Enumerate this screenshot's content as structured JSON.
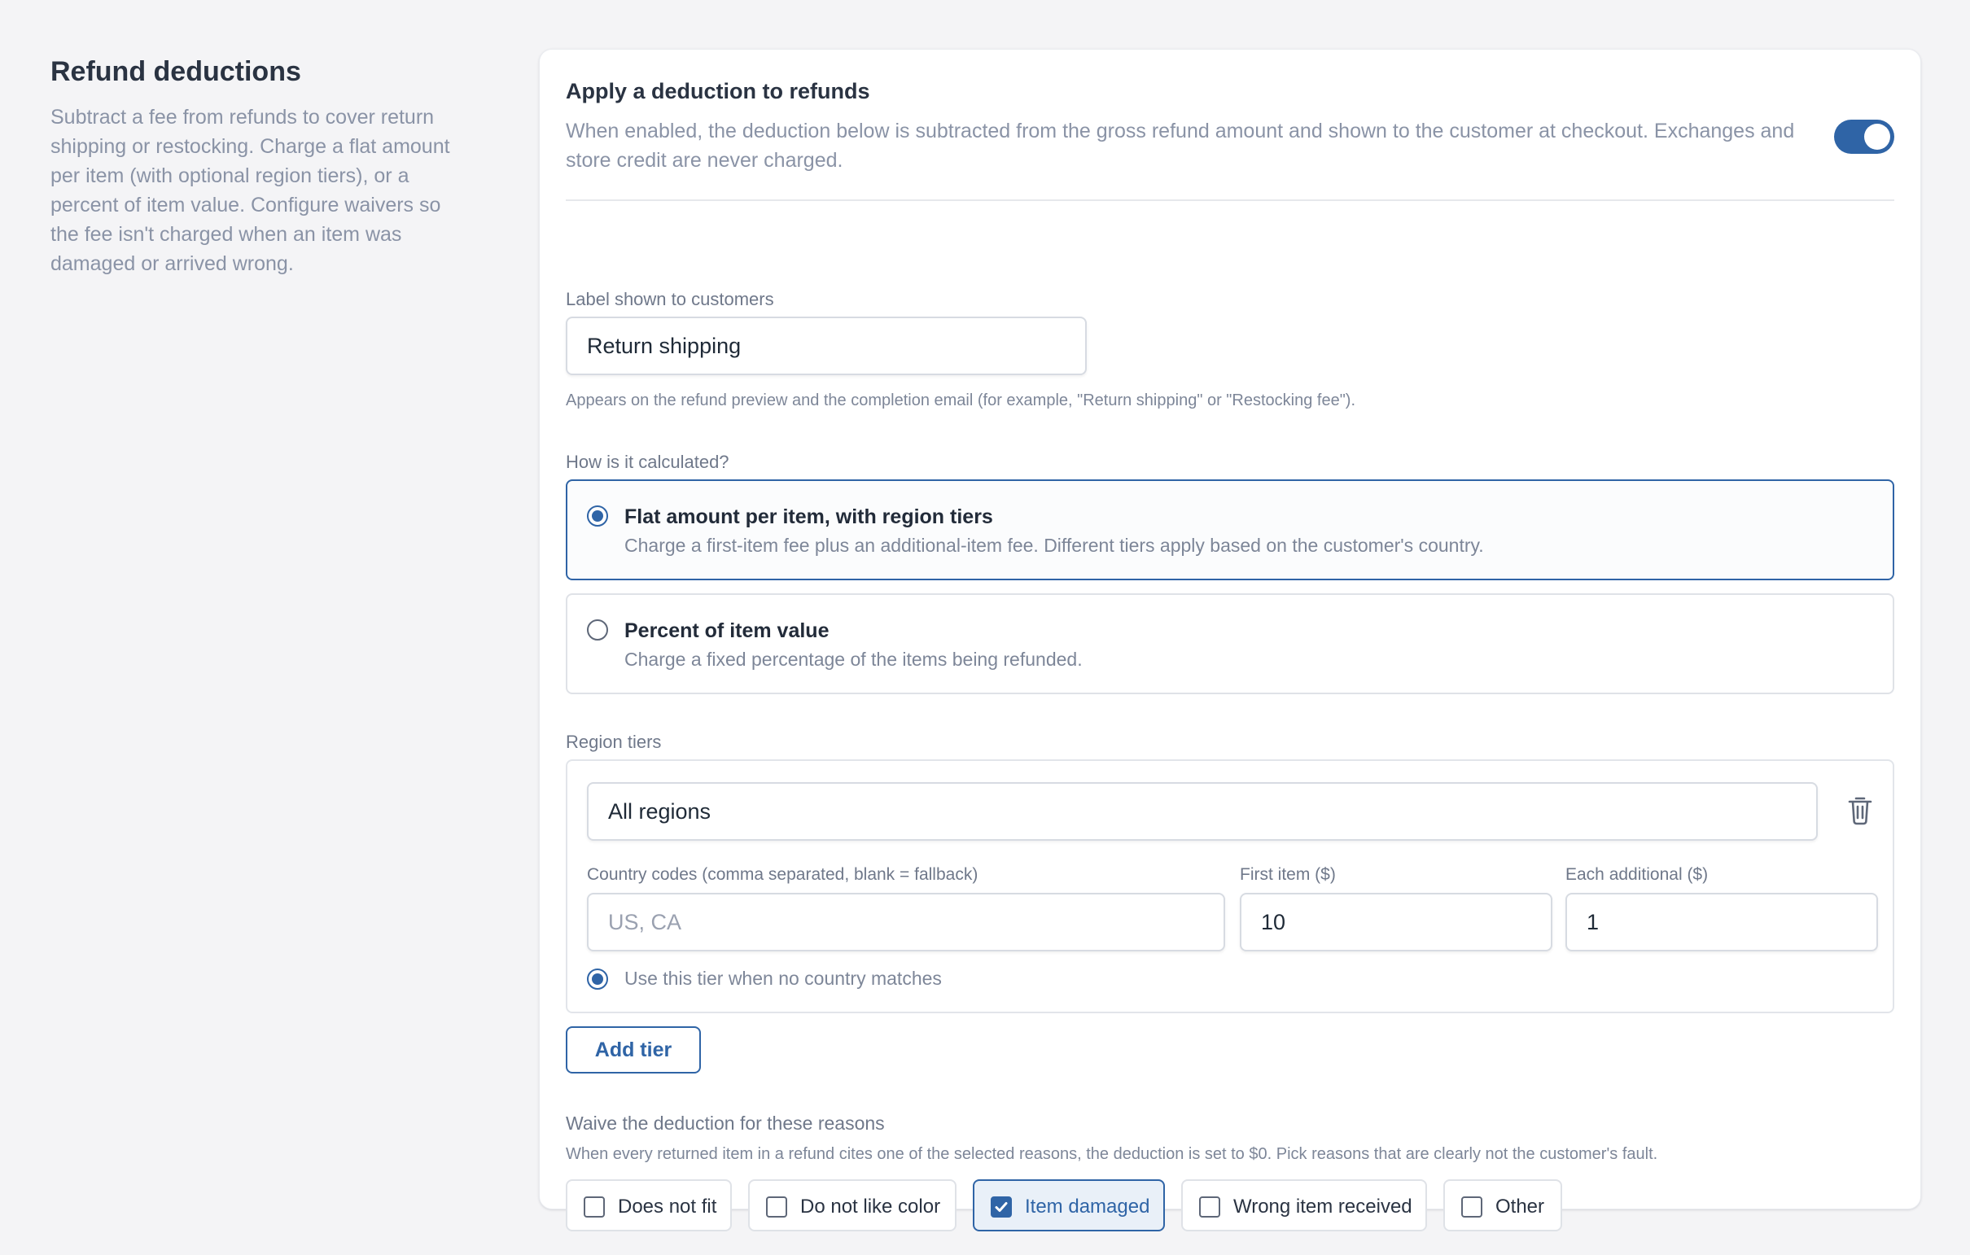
{
  "intro": {
    "title": "Refund deductions",
    "description": "Subtract a fee from refunds to cover return shipping or restocking. Charge a flat amount per item (with optional region tiers), or a percent of item value. Configure waivers so the fee isn't charged when an item was damaged or arrived wrong."
  },
  "enable": {
    "title": "Apply a deduction to refunds",
    "description": "When enabled, the deduction below is subtracted from the gross refund amount and shown to the customer at checkout. Exchanges and store credit are never charged.",
    "enabled": true
  },
  "label_field": {
    "label": "Label shown to customers",
    "value": "Return shipping",
    "helper": "Appears on the refund preview and the completion email (for example, \"Return shipping\" or \"Restocking fee\")."
  },
  "calculation": {
    "label": "How is it calculated?",
    "options": [
      {
        "title": "Flat amount per item, with region tiers",
        "description": "Charge a first-item fee plus an additional-item fee. Different tiers apply based on the customer's country.",
        "selected": true
      },
      {
        "title": "Percent of item value",
        "description": "Charge a fixed percentage of the items being refunded.",
        "selected": false
      }
    ]
  },
  "tiers": {
    "label": "Region tiers",
    "tier": {
      "name": "All regions",
      "country_codes_label": "Country codes (comma separated, blank = fallback)",
      "country_codes_placeholder": "US, CA",
      "country_codes_value": "",
      "first_item_label": "First item ($)",
      "first_item_value": "10",
      "each_additional_label": "Each additional ($)",
      "each_additional_value": "1",
      "fallback_label": "Use this tier when no country matches",
      "fallback_selected": true
    },
    "add_button": "Add tier"
  },
  "waive": {
    "label": "Waive the deduction for these reasons",
    "description": "When every returned item in a refund cites one of the selected reasons, the deduction is set to $0. Pick reasons that are clearly not the customer's fault.",
    "reasons": [
      {
        "label": "Does not fit",
        "checked": false
      },
      {
        "label": "Do not like color",
        "checked": false
      },
      {
        "label": "Item damaged",
        "checked": true
      },
      {
        "label": "Wrong item received",
        "checked": false
      },
      {
        "label": "Other",
        "checked": false
      }
    ]
  },
  "colors": {
    "accent": "#2f64a6",
    "muted_text": "#8a93a6",
    "page_background": "#f4f4f6"
  },
  "icons": {
    "delete_tier": "trash-icon",
    "checkbox_checked": "check-icon"
  }
}
